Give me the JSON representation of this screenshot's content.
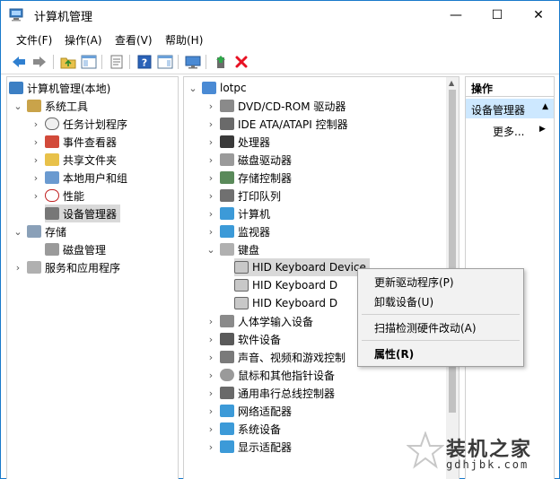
{
  "window": {
    "title": "计算机管理",
    "minimize_glyph": "—",
    "maximize_glyph": "☐",
    "close_glyph": "✕"
  },
  "menu": [
    "文件(F)",
    "操作(A)",
    "查看(V)",
    "帮助(H)"
  ],
  "toolbar": {
    "icons": [
      "back-icon",
      "forward-icon",
      "up-folder-icon",
      "show-hide-tree-icon",
      "properties-icon",
      "help-icon",
      "action-pane-icon",
      "monitor-icon",
      "update-driver-icon",
      "uninstall-icon"
    ]
  },
  "left_tree": {
    "root": "计算机管理(本地)",
    "system_tools": "系统工具",
    "system_items": [
      "任务计划程序",
      "事件查看器",
      "共享文件夹",
      "本地用户和组",
      "性能",
      "设备管理器"
    ],
    "storage": "存储",
    "storage_items": [
      "磁盘管理"
    ],
    "services": "服务和应用程序"
  },
  "device_tree": {
    "root": "lotpc",
    "categories_top": [
      "DVD/CD-ROM 驱动器",
      "IDE ATA/ATAPI 控制器",
      "处理器",
      "磁盘驱动器",
      "存储控制器",
      "打印队列",
      "计算机",
      "监视器"
    ],
    "keyboard": "键盘",
    "keyboard_items": [
      "HID Keyboard Device",
      "HID Keyboard D",
      "HID Keyboard D"
    ],
    "categories_bottom": [
      "人体学输入设备",
      "软件设备",
      "声音、视频和游戏控制",
      "鼠标和其他指针设备",
      "通用串行总线控制器",
      "网络适配器",
      "系统设备",
      "显示适配器"
    ]
  },
  "actions_pane": {
    "header": "操作",
    "section": "设备管理器",
    "more": "更多..."
  },
  "context_menu": {
    "update_driver": "更新驱动程序(P)",
    "uninstall": "卸载设备(U)",
    "scan": "扫描检测硬件改动(A)",
    "properties": "属性(R)"
  },
  "watermark": {
    "title": "装机之家",
    "url": "gdhjbk.com"
  },
  "colors": {
    "accent": "#0078d7",
    "selection": "#d9d9d9",
    "actions_highlight": "#cde8ff",
    "uninstall_red": "#e81123"
  }
}
